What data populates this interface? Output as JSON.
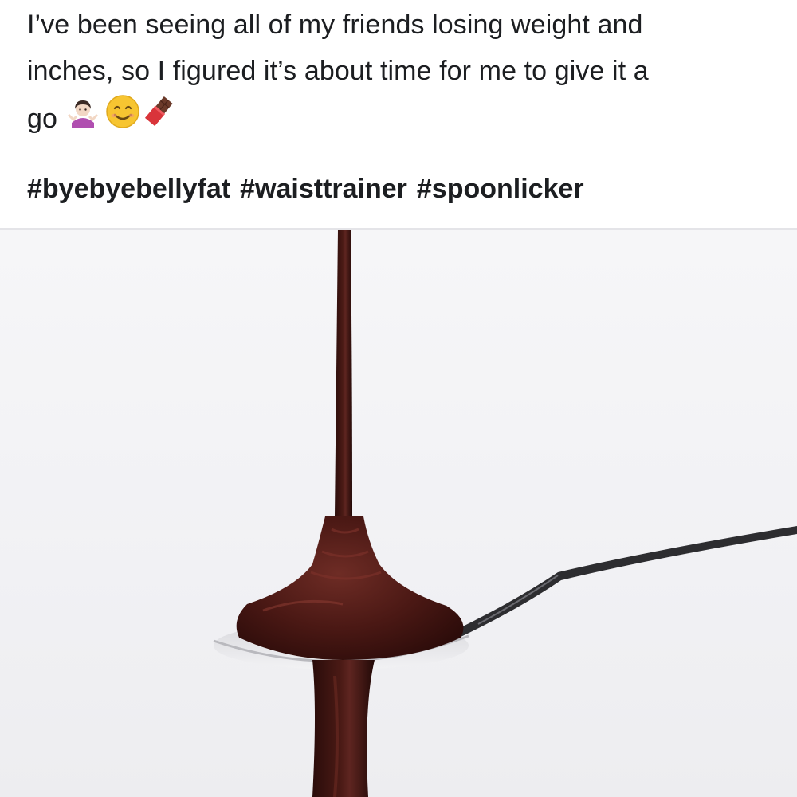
{
  "post": {
    "text_lines": [
      "I’ve been seeing all of my friends losing weight and",
      "inches, so I figured it’s about time for me to give it a",
      "go"
    ],
    "emojis": [
      "woman-shrugging-icon",
      "smiling-face-icon",
      "chocolate-bar-icon"
    ],
    "hashtags": [
      "#byebyebellyfat",
      "#waisttrainer",
      "#spoonlicker"
    ]
  },
  "photo": {
    "subject": "chocolate-sauce-on-spoon",
    "colors": {
      "background": "#f3f3f6",
      "chocolate": "#3a1411",
      "chocolate_highlight": "#6b2a22",
      "spoon": "#2a2a2c"
    }
  }
}
